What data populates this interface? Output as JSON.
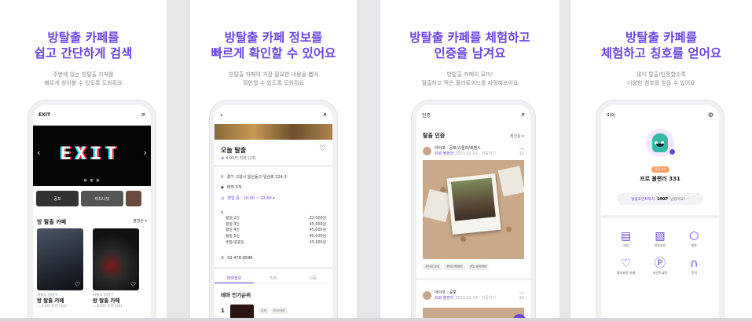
{
  "panels": [
    {
      "headline": [
        "방탈출 카페를",
        "쉽고 간단하게 검색"
      ],
      "subtext": [
        "주변에 있는 방탈출 카페를",
        "빠르게 찾아볼 수 있도록 도와줘요"
      ],
      "phone": {
        "app_title": "EXIT",
        "hero_text": "EXIT",
        "thumb_labels": [
          "공포",
          "미드나잇",
          ""
        ],
        "section_title": "방 탈출 카페",
        "sort_label": "평점순 ▾",
        "cards": [
          {
            "location": "서울시 강남구",
            "name": "방 탈출 카페",
            "meta": "☆ 0.0/5   리뷰 (23)"
          },
          {
            "location": "서울시 강남구",
            "name": "방 탈출 카페",
            "meta": "☆ 0.0/5   리뷰 (23)"
          }
        ]
      }
    },
    {
      "headline": [
        "방탈출 카페 정보를",
        "빠르게 확인할 수 있어요"
      ],
      "subtext": [
        "방탈출 카페의 가장 필요한 내용을 뽑아",
        "확인할 수 있도록 도와줘요"
      ],
      "phone": {
        "title": "오늘 탈출",
        "rating": "4.93/5   리뷰 (23)",
        "address": "경기 고양시 일산동구 일산로 224-3",
        "theme_count": "테마 5개",
        "hours": "영업 중 · 10:00 ~ 22:00 ▾",
        "prices": [
          {
            "label": "평일 2인",
            "value": "32,000원"
          },
          {
            "label": "평일 3인",
            "value": "45,000원"
          },
          {
            "label": "평일 4인",
            "value": "45,000원"
          },
          {
            "label": "평일 5인",
            "value": "45,000원"
          },
          {
            "label": "주말/공휴일",
            "value": "45,000원"
          }
        ],
        "phone_number": "02-478-8596",
        "tabs": [
          "테마정보",
          "리뷰",
          "인증"
        ],
        "rank_title": "테마 인기순위",
        "rank_no": "1",
        "rank_chips": [
          "공포",
          "미스터리"
        ]
      }
    },
    {
      "headline": [
        "방탈출 카페를 체험하고",
        "인증을 남겨요"
      ],
      "subtext": [
        "방탈출 카페의 묘미!",
        "탈출하고 찍은 폴라로이드를 자랑해보아요"
      ],
      "phone": {
        "app_title": "인증",
        "section_title": "탈출 인증",
        "sort_label": "최신순 ▾",
        "posts": [
          {
            "author": "아이코 · 공포/스릴러/로맨스",
            "level": "프로 불편러",
            "date": "2023.01.01 · 인증하기",
            "likes": "22"
          },
          {
            "author": "아이코 · 공포",
            "level": "프로 불편러",
            "date": "2023.01.01 · 인증하기",
            "likes": "22"
          }
        ],
        "tags": [
          "#신비고어",
          "#4단계해석",
          "#무서워해야"
        ]
      }
    },
    {
      "headline": [
        "방탈출 카페를",
        "체험하고 칭호를 얻어요"
      ],
      "subtext": [
        "많이 탈출/인증할수록",
        "다양한 칭호를 얻을 수 있어요"
      ],
      "phone": {
        "app_title": "마이",
        "level_chip": "탈출고수",
        "nickname": "프로 불편러 331",
        "points_prefix": "탈출포인트까지",
        "points_value": "100P",
        "points_suffix": "남았어요!",
        "grid": [
          {
            "icon": "▤",
            "label": "리뷰"
          },
          {
            "icon": "▧",
            "label": "인증사진"
          },
          {
            "icon": "⬡",
            "label": "칭호"
          },
          {
            "icon": "♡",
            "label": "좋아요한 카페"
          },
          {
            "icon": "Ⓟ",
            "label": "포인트내역"
          },
          {
            "icon": "∩",
            "label": "문의"
          }
        ]
      }
    }
  ],
  "colors": {
    "accent": "#6b45e8",
    "background": "#e6e6e9"
  }
}
